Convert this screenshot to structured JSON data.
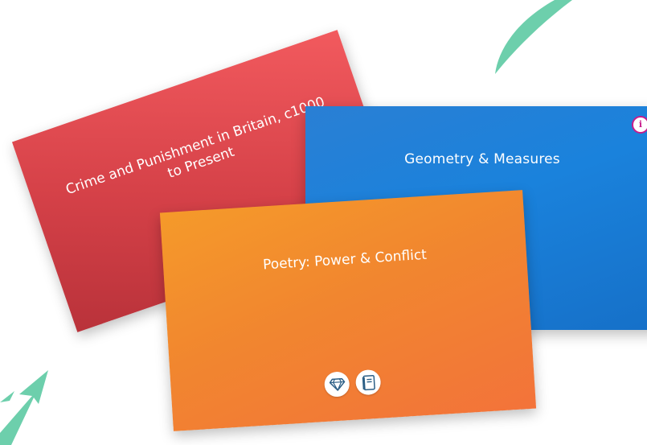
{
  "cards": {
    "red": {
      "title": "Crime and Punishment in Britain, c1000 to Present",
      "color": "#d5424a"
    },
    "blue": {
      "title": "Geometry & Measures",
      "color": "#1a82dc",
      "info_icon": "info-icon"
    },
    "orange": {
      "title": "Poetry: Power & Conflict",
      "color": "#f38a30",
      "icons": [
        "gem-icon",
        "book-icon"
      ]
    }
  },
  "decor": {
    "leaf_color": "#6dcfac",
    "arrow_color": "#6dcfac"
  }
}
